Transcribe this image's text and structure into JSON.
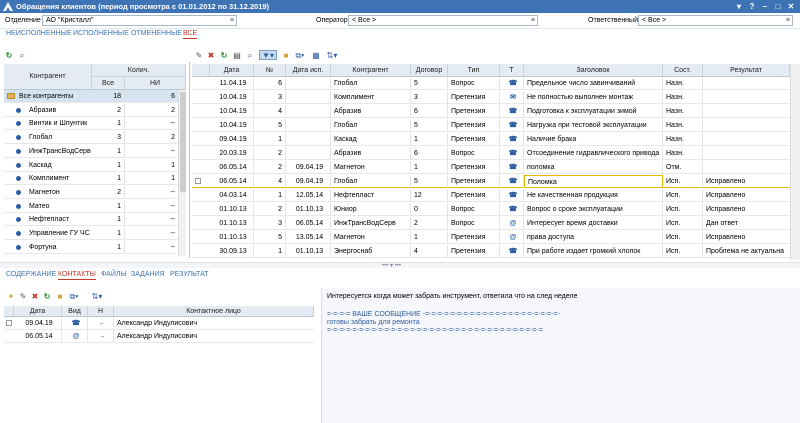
{
  "window": {
    "title": "Обращения клиентов (период просмотра с 01.01.2012 по 31.12.2019)",
    "buttons": [
      "▾",
      "?",
      "–",
      "□",
      "✕"
    ]
  },
  "filters": {
    "dept_label": "Отделение",
    "dept_value": "АО \"Кристалл\"",
    "operator_label": "Оператор",
    "operator_value": "< Все >",
    "resp_label": "Ответственный",
    "resp_value": "< Все >"
  },
  "tabs": [
    "НЕИСПОЛНЕННЫЕ",
    "ИСПОЛНЕННЫЕ",
    "ОТМЕНЕННЫЕ",
    "ВСЕ"
  ],
  "left": {
    "hdr_contragent": "Контрагент",
    "hdr_count": "Колич.",
    "hdr_all": "Все",
    "hdr_ni": "НИ",
    "rows": [
      {
        "name": "Все контрагенты",
        "all": "18",
        "ni": "6"
      },
      {
        "name": "Абразив",
        "all": "2",
        "ni": "2"
      },
      {
        "name": "Винтик и Шпунтик",
        "all": "1",
        "ni": "--"
      },
      {
        "name": "Глобал",
        "all": "3",
        "ni": "2"
      },
      {
        "name": "ИнжТрансВодСерв",
        "all": "1",
        "ni": "--"
      },
      {
        "name": "Каскад",
        "all": "1",
        "ni": "1"
      },
      {
        "name": "Комплимент",
        "all": "1",
        "ni": "1"
      },
      {
        "name": "Магнетон",
        "all": "2",
        "ni": "--"
      },
      {
        "name": "Матео",
        "all": "1",
        "ni": "--"
      },
      {
        "name": "Нефтепласт",
        "all": "1",
        "ni": "--"
      },
      {
        "name": "Управление ГУ ЧС",
        "all": "1",
        "ni": "--"
      },
      {
        "name": "Фортуна",
        "all": "1",
        "ni": "--"
      }
    ]
  },
  "main": {
    "headers": [
      "Дата",
      "№",
      "Дата исп.",
      "Контрагент",
      "Договор",
      "Тип",
      "Т",
      "Заголовок",
      "Сост.",
      "Результат"
    ],
    "rows": [
      {
        "date": "11.04.19",
        "no": "6",
        "done": "",
        "ctr": "Глобал",
        "dog": "5",
        "type": "Вопрос",
        "t": "☎",
        "title": "Предельное число завинчиваний",
        "st": "Назн.",
        "res": ""
      },
      {
        "date": "10.04.19",
        "no": "3",
        "done": "",
        "ctr": "Комплимент",
        "dog": "3",
        "type": "Претензия",
        "t": "✉",
        "title": "Не полностью выполнен монтаж",
        "st": "Назн.",
        "res": ""
      },
      {
        "date": "10.04.19",
        "no": "4",
        "done": "",
        "ctr": "Абразив",
        "dog": "6",
        "type": "Претензия",
        "t": "☎",
        "title": "Подготовка к эксплуатации зимой",
        "st": "Назн.",
        "res": ""
      },
      {
        "date": "10.04.19",
        "no": "5",
        "done": "",
        "ctr": "Глобал",
        "dog": "5",
        "type": "Претензия",
        "t": "☎",
        "title": "Нагрузка при тестовой эксплуатации",
        "st": "Назн.",
        "res": ""
      },
      {
        "date": "09.04.19",
        "no": "1",
        "done": "",
        "ctr": "Каскад",
        "dog": "1",
        "type": "Претензия",
        "t": "☎",
        "title": "Наличие брака",
        "st": "Назн.",
        "res": ""
      },
      {
        "date": "20.03.19",
        "no": "2",
        "done": "",
        "ctr": "Абразив",
        "dog": "6",
        "type": "Вопрос",
        "t": "☎",
        "title": "Отсоединение гидравлического привода",
        "st": "Назн.",
        "res": ""
      },
      {
        "date": "06.05.14",
        "no": "2",
        "done": "09.04.19",
        "ctr": "Магнетон",
        "dog": "1",
        "type": "Претензия",
        "t": "☎",
        "title": "поломка",
        "st": "Отм.",
        "res": ""
      },
      {
        "date": "06.05.14",
        "no": "4",
        "done": "09.04.19",
        "ctr": "Глобал",
        "dog": "5",
        "type": "Претензия",
        "t": "☎",
        "title": "Поломка",
        "st": "Исп.",
        "res": "Исправлено"
      },
      {
        "date": "04.03.14",
        "no": "1",
        "done": "12.05.14",
        "ctr": "Нефтепласт",
        "dog": "12",
        "type": "Претензия",
        "t": "☎",
        "title": "Не качественная продукция",
        "st": "Исп.",
        "res": "Исправлено"
      },
      {
        "date": "01.10.13",
        "no": "2",
        "done": "01.10.13",
        "ctr": "Юниор",
        "dog": "0",
        "type": "Вопрос",
        "t": "☎",
        "title": "Вопрос о сроке эксплуатации",
        "st": "Исп.",
        "res": "Исправлено"
      },
      {
        "date": "01.10.13",
        "no": "3",
        "done": "06.05.14",
        "ctr": "ИнжТрансВодСерв",
        "dog": "2",
        "type": "Вопрос",
        "t": "@",
        "title": "Интересует время доставки",
        "st": "Исп.",
        "res": "Дан ответ"
      },
      {
        "date": "01.10.13",
        "no": "5",
        "done": "13.05.14",
        "ctr": "Магнетон",
        "dog": "1",
        "type": "Претензия",
        "t": "@",
        "title": "права доступа",
        "st": "Исп.",
        "res": "Исправлено"
      },
      {
        "date": "30.09.13",
        "no": "1",
        "done": "01.10.13",
        "ctr": "Энергоснаб",
        "dog": "4",
        "type": "Претензия",
        "t": "☎",
        "title": "При работе издает громкий хлопок",
        "st": "Исп.",
        "res": "Проблема не актуальна"
      }
    ]
  },
  "bottom_tabs": [
    "СОДЕРЖАНИЕ",
    "КОНТАКТЫ",
    "ФАЙЛЫ",
    "ЗАДАНИЯ",
    "РЕЗУЛЬТАТ"
  ],
  "contacts": {
    "headers": [
      "Дата",
      "Вид",
      "Н",
      "Контактное лицо"
    ],
    "rows": [
      {
        "date": "09.04.19",
        "vid": "☎",
        "n": "←",
        "person": "Александр Индулисович"
      },
      {
        "date": "06.05.14",
        "vid": "@",
        "n": "→",
        "person": "Александр Индулисович"
      }
    ]
  },
  "message": {
    "line1": "Интересуется когда может забрать инструмент, ответила что на след неделе",
    "line2": "=-=-=-= ВАШЕ СООБЩЕНИЕ -=-=-=-=-=-=-=-=-=-=-=-=-=-=-=-=-=-=-=-=-=-",
    "line3": "готовы забрать для ремонта",
    "line4": "=-=-=-=-=-=-=-=-=-=-=-=-=-=-=-=-=-=-=-=-=-=-=-=-=-=-=-=-=-=-=-=-=-="
  },
  "colors": {
    "title": "#3e74b6",
    "tab": "#3e74b6",
    "active": "#c0392b",
    "header": "#e4ebf3",
    "selected": "#2e5ea3"
  }
}
